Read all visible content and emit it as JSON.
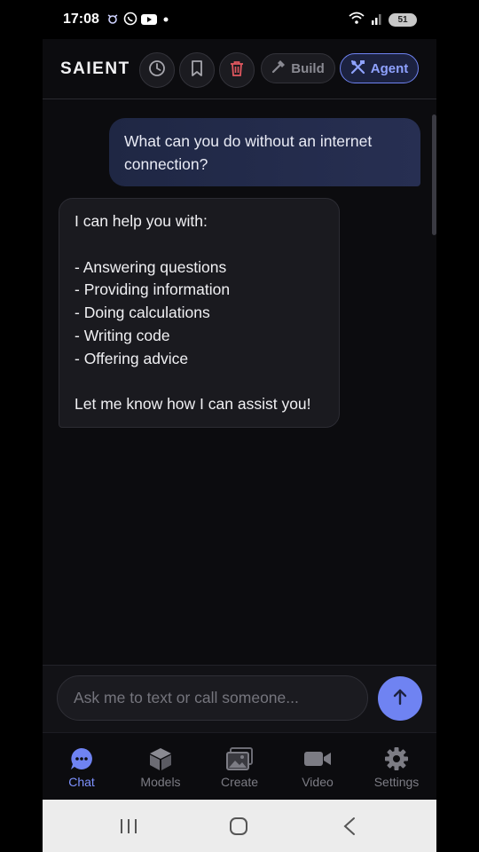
{
  "status_bar": {
    "time": "17:08",
    "battery": "51",
    "icons": [
      "notification-icon",
      "whatsapp-icon",
      "youtube-icon",
      "dot-icon",
      "wifi-icon",
      "signal-icon",
      "battery-icon"
    ]
  },
  "header": {
    "brand": "SAIENT",
    "history_icon": "clock-icon",
    "bookmark_icon": "bookmark-icon",
    "delete_icon": "trash-icon",
    "build_label": "Build",
    "agent_label": "Agent"
  },
  "chat": {
    "messages": [
      {
        "role": "user",
        "lines": [
          "What can you do without an internet",
          "connection?"
        ]
      },
      {
        "role": "assistant",
        "lines": [
          "I can help you with:",
          "",
          "- Answering questions",
          "- Providing information",
          "- Doing calculations",
          "- Writing code",
          "- Offering advice",
          "",
          "Let me know how I can assist you!"
        ]
      }
    ]
  },
  "composer": {
    "placeholder": "Ask me to text or call someone...",
    "send_icon": "arrow-up-icon"
  },
  "tabs": [
    {
      "label": "Chat",
      "icon": "chat-icon",
      "active": true
    },
    {
      "label": "Models",
      "icon": "cube-icon",
      "active": false
    },
    {
      "label": "Create",
      "icon": "images-icon",
      "active": false
    },
    {
      "label": "Video",
      "icon": "video-icon",
      "active": false
    },
    {
      "label": "Settings",
      "icon": "gear-icon",
      "active": false
    }
  ],
  "colors": {
    "accent": "#6f83f2",
    "delete": "#e0575f",
    "background": "#0c0c0f"
  }
}
